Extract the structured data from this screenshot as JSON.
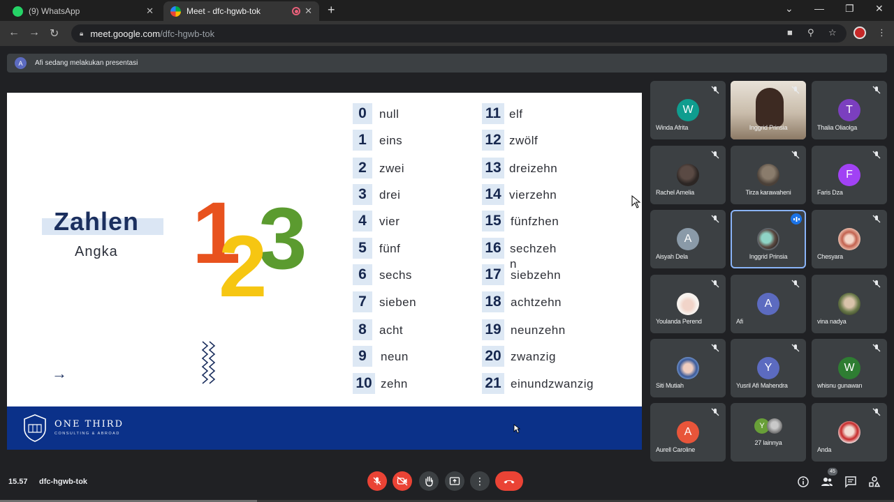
{
  "browser": {
    "tabs": [
      {
        "title": "(9) WhatsApp",
        "favicon": "whatsapp-icon",
        "color": "#25d366"
      },
      {
        "title": "Meet - dfc-hgwb-tok",
        "favicon": "google-meet-icon",
        "color": "#00ac47",
        "active": true
      }
    ],
    "new_tab_label": "+",
    "url_host": "meet.google.com",
    "url_path": "/dfc-hgwb-tok"
  },
  "banner": {
    "avatar_letter": "A",
    "text": "Afi sedang melakukan presentasi"
  },
  "slide": {
    "title": "Zahlen",
    "subtitle": "Angka",
    "arrow": "→",
    "brand_name": "ONE THIRD",
    "brand_tagline": "CONSULTING & ABROAD",
    "numbers_left": [
      {
        "num": "0",
        "word": "null"
      },
      {
        "num": "1",
        "word": "eins"
      },
      {
        "num": "2",
        "word": "zwei"
      },
      {
        "num": "3",
        "word": "drei"
      },
      {
        "num": "4",
        "word": "vier"
      },
      {
        "num": "5",
        "word": "fünf"
      },
      {
        "num": "6",
        "word": "sechs"
      },
      {
        "num": "7",
        "word": "sieben"
      },
      {
        "num": "8",
        "word": "acht"
      },
      {
        "num": "9",
        "word": "neun"
      },
      {
        "num": "10",
        "word": "zehn"
      }
    ],
    "numbers_right": [
      {
        "num": "11",
        "word": "elf"
      },
      {
        "num": "12",
        "word": "zwölf"
      },
      {
        "num": "13",
        "word": "dreizehn"
      },
      {
        "num": "14",
        "word": "vierzehn"
      },
      {
        "num": "15",
        "word": "fünfzhen"
      },
      {
        "num": "16",
        "word": "sechzeh"
      },
      {
        "num": "17",
        "word": "siebzehn"
      },
      {
        "num": "18",
        "word": "achtzehn"
      },
      {
        "num": "19",
        "word": "neunzehn"
      },
      {
        "num": "20",
        "word": "zwanzig"
      },
      {
        "num": "21",
        "word": "einundzwanzig"
      }
    ],
    "wrap_fragment": "n",
    "big_digits": [
      {
        "digit": "1",
        "color": "#e8521e"
      },
      {
        "digit": "2",
        "color": "#f6c612"
      },
      {
        "digit": "3",
        "color": "#5b9b2f"
      }
    ]
  },
  "participants": [
    {
      "name": "Winda Afrita",
      "letter": "W",
      "color": "#0f9d8f"
    },
    {
      "name": "Inggrid Prinsia",
      "photo": true
    },
    {
      "name": "Thalia Oliaolga",
      "letter": "T",
      "color": "#7b3fbf"
    },
    {
      "name": "Rachel Amelia",
      "photo": true
    },
    {
      "name": "Tirza karawaheni",
      "photo": true
    },
    {
      "name": "Faris Dza",
      "letter": "F",
      "color": "#a142f4"
    },
    {
      "name": "Aisyah Dela",
      "letter": "A",
      "color": "#8a9aa8"
    },
    {
      "name": "Inggrid Prinsia",
      "photo": true,
      "speaking": true
    },
    {
      "name": "Chesyara",
      "photo": true
    },
    {
      "name": "Youlanda Perend",
      "photo": true
    },
    {
      "name": "Afi",
      "letter": "A",
      "color": "#5c6bc0"
    },
    {
      "name": "vina nadya",
      "photo": true
    },
    {
      "name": "Siti Mutiah",
      "photo": true
    },
    {
      "name": "Yusril Afi Mahendra",
      "letter": "Y",
      "color": "#5c6bc0"
    },
    {
      "name": "whisnu gunawan",
      "letter": "W",
      "color": "#2e7d32"
    },
    {
      "name": "Aurell Caroline",
      "letter": "A",
      "color": "#e8553a"
    },
    {
      "name": "27 lainnya",
      "letter": "Y",
      "color": "#689f38",
      "others": true
    },
    {
      "name": "Anda",
      "photo": true
    }
  ],
  "bottom": {
    "time": "15.57",
    "meeting_code": "dfc-hgwb-tok",
    "people_count": "45"
  },
  "colors": {
    "end_call": "#ea4335",
    "slide_footer": "#0b3189",
    "speaking_outline": "#8ab4f8"
  }
}
